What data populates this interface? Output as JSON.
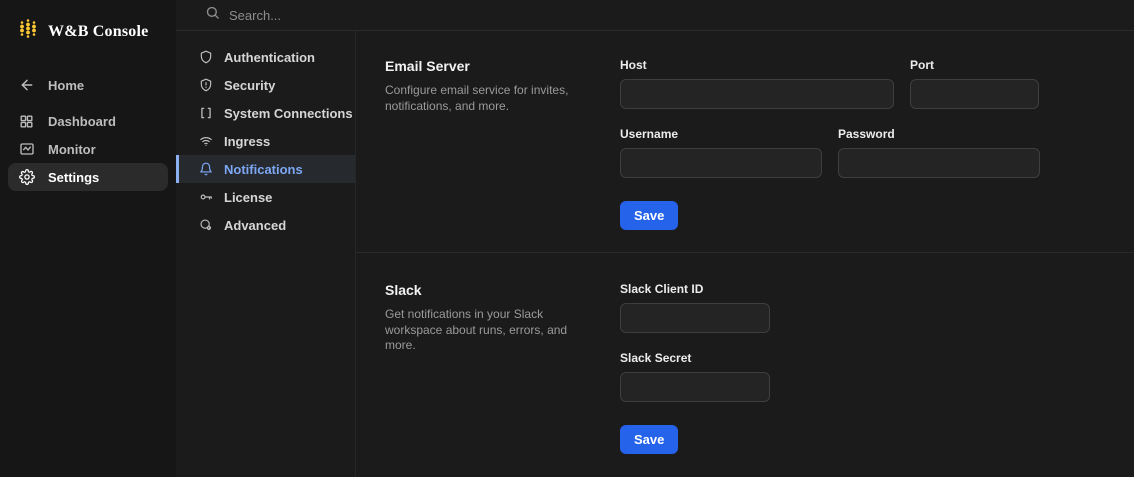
{
  "brand": {
    "title": "W&B Console",
    "logo_icon": "wandb-dots-logo",
    "logo_color": "#FFC933"
  },
  "search": {
    "placeholder": "Search...",
    "icon": "search-icon"
  },
  "primary_nav": [
    {
      "label": "Home",
      "icon": "back-arrow-icon",
      "active": false
    },
    {
      "label": "Dashboard",
      "icon": "dashboard-grid-icon",
      "active": false
    },
    {
      "label": "Monitor",
      "icon": "monitor-chart-icon",
      "active": false
    },
    {
      "label": "Settings",
      "icon": "gear-icon",
      "active": true
    }
  ],
  "secondary_nav": [
    {
      "label": "Authentication",
      "icon": "shield-icon",
      "active": false
    },
    {
      "label": "Security",
      "icon": "shield-exclamation-icon",
      "active": false
    },
    {
      "label": "System Connections",
      "icon": "brackets-icon",
      "active": false
    },
    {
      "label": "Ingress",
      "icon": "wifi-icon",
      "active": false
    },
    {
      "label": "Notifications",
      "icon": "bell-icon",
      "active": true
    },
    {
      "label": "License",
      "icon": "key-icon",
      "active": false
    },
    {
      "label": "Advanced",
      "icon": "advanced-gear-icon",
      "active": false
    }
  ],
  "sections": [
    {
      "title": "Email Server",
      "description": "Configure email service for invites, notifications, and more.",
      "fields": [
        {
          "label": "Host",
          "value": ""
        },
        {
          "label": "Port",
          "value": ""
        },
        {
          "label": "Username",
          "value": ""
        },
        {
          "label": "Password",
          "value": ""
        }
      ],
      "save_label": "Save"
    },
    {
      "title": "Slack",
      "description": "Get notifications in your Slack workspace about runs, errors, and more.",
      "fields": [
        {
          "label": "Slack Client ID",
          "value": ""
        },
        {
          "label": "Slack Secret",
          "value": ""
        }
      ],
      "save_label": "Save"
    }
  ],
  "colors": {
    "page_bg": "#1b1b1b",
    "sidebar_bg": "#161616",
    "accent_blue": "#2563eb",
    "selected_nav_text": "#7da7f4",
    "selected_nav_border": "#8ab0f0",
    "logo_yellow": "#FFC933",
    "input_bg": "#242424",
    "input_border": "#3e3e3e",
    "divider": "#2a2a2a"
  }
}
